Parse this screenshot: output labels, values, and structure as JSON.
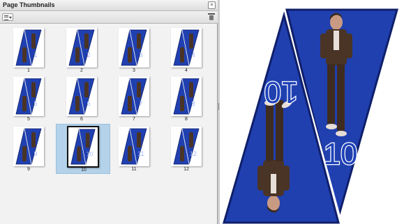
{
  "panel": {
    "title": "Page Thumbnails",
    "close_glyph": "×",
    "options_icon": "options-menu-icon",
    "delete_icon": "trash-icon"
  },
  "thumbnails": [
    {
      "label": "1"
    },
    {
      "label": "2"
    },
    {
      "label": "3"
    },
    {
      "label": "4"
    },
    {
      "label": "5"
    },
    {
      "label": "6"
    },
    {
      "label": "7"
    },
    {
      "label": "8"
    },
    {
      "label": "9"
    },
    {
      "label": "10"
    },
    {
      "label": "11"
    },
    {
      "label": "12"
    }
  ],
  "selected_page": "10",
  "preview": {
    "number_top": "10",
    "number_bottom": "10"
  },
  "colors": {
    "pennant_blue": "#2040b0",
    "pennant_edge": "#0f1f6a",
    "selection": "#b4d3ea"
  }
}
